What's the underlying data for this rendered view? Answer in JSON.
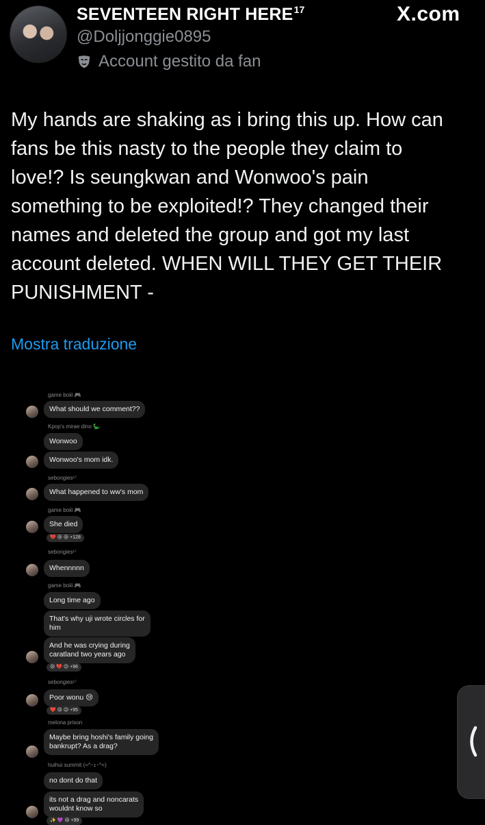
{
  "header": {
    "display_name": "SEVENTEEN RIGHT HERE",
    "name_suffix": "17",
    "handle": "@Doljjonggie0895",
    "fan_label": "Account gestito da fan",
    "site": "X.com"
  },
  "tweet": {
    "text": "My hands are shaking as i bring this up. How can\nfans be this nasty to the people they claim to\nlove!? Is seungkwan and Wonwoo's pain\nsomething to be exploited!? They changed their\nnames and deleted the group and got my last\naccount deleted. WHEN WILL THEY GET THEIR\nPUNISHMENT -",
    "translate_label": "Mostra traduzione"
  },
  "chat": {
    "nicks": [
      "game boiii 🎮",
      "Kpop's mirae dino 🦕",
      "sebongies¹⁷",
      "game boiii 🎮",
      "sebongies¹⁷",
      "game boiii 🎮",
      "sebongies¹⁷",
      "melona prison",
      "huihui summit (=^･ｪ･^=)"
    ],
    "messages": [
      "What should we comment??",
      "Wonwoo",
      "Wonwoo's mom idk.",
      "What happened to ww's mom",
      "She died",
      "Whennnnn",
      "Long time ago",
      "That's why uji wrote circles for\nhim",
      "And he was crying during\ncaratland two years ago",
      "Poor wonu 😢",
      "Maybe bring hoshi's family going\nbankrupt? As a drag?",
      "no dont do that",
      "its not a drag and noncarats\nwouldnt know so"
    ],
    "reactions": [
      "💔 😢 😢 +128",
      "😢 💔 😥 +96",
      "❤️ 😢 😥 +95",
      "✨ 💜 😢 +99"
    ]
  },
  "colors": {
    "background": "#000000",
    "link": "#1d9bf0",
    "muted": "#8b8f94",
    "bubble": "#262626"
  },
  "icons": [
    "avatar",
    "mask-icon",
    "chevron-left-icon"
  ]
}
